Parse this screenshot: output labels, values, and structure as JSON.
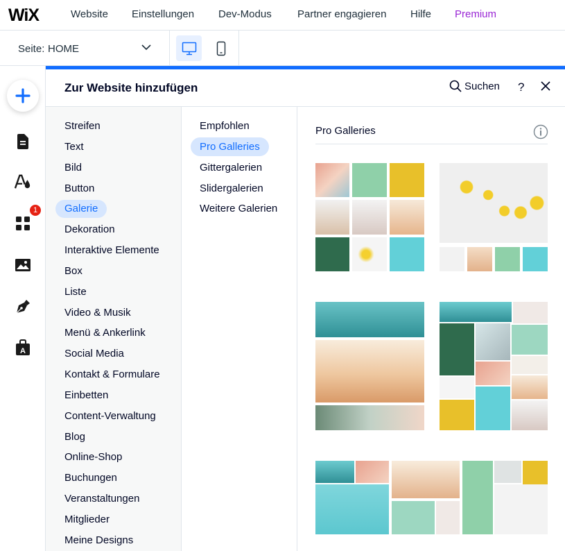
{
  "topnav": {
    "logo": "WiX",
    "items": [
      "Website",
      "Einstellungen",
      "Dev-Modus",
      "Partner engagieren",
      "Hilfe"
    ],
    "premium": "Premium",
    "premium_color": "#9a27d5"
  },
  "subbar": {
    "page_label": "Seite:",
    "page_value": "HOME"
  },
  "rail": {
    "badge_count": "1",
    "icons": [
      "add-icon",
      "pages-icon",
      "theme-icon",
      "apps-icon",
      "media-icon",
      "pen-icon",
      "portfolio-icon"
    ]
  },
  "panel": {
    "title": "Zur Website hinzufügen",
    "search_label": "Suchen",
    "help_label": "?",
    "accent_color": "#116dff"
  },
  "categories": [
    "Streifen",
    "Text",
    "Bild",
    "Button",
    "Galerie",
    "Dekoration",
    "Interaktive Elemente",
    "Box",
    "Liste",
    "Video & Musik",
    "Menü & Ankerlink",
    "Social Media",
    "Kontakt & Formulare",
    "Einbetten",
    "Content-Verwaltung",
    "Blog",
    "Online-Shop",
    "Buchungen",
    "Veranstaltungen",
    "Mitglieder",
    "Meine Designs"
  ],
  "active_category": "Galerie",
  "subcategories": [
    "Empfohlen",
    "Pro Galleries",
    "Gittergalerien",
    "Slidergalerien",
    "Weitere Galerien"
  ],
  "active_subcategory": "Pro Galleries",
  "content": {
    "section_title": "Pro Galleries"
  }
}
